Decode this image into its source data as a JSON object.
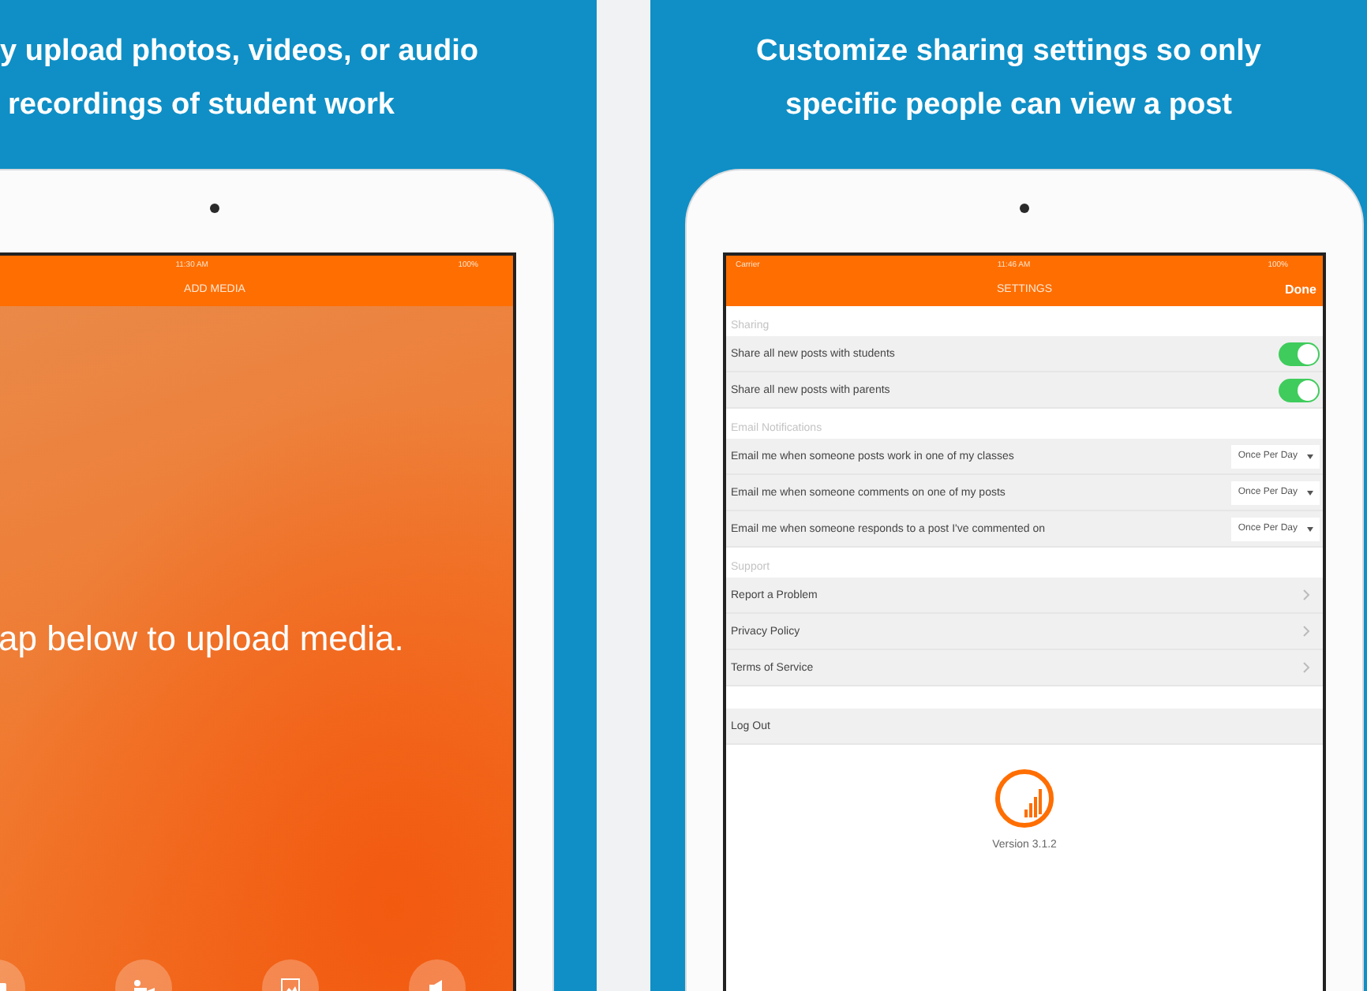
{
  "left_panel": {
    "caption": [
      "y upload photos, videos, or audio",
      "recordings of student work"
    ],
    "screen": {
      "time": "11:30 AM",
      "battery": "100%",
      "title": "ADD MEDIA",
      "prompt": "ap below to upload media."
    }
  },
  "right_panel": {
    "caption": [
      "Customize sharing settings so only",
      "specific people can view a post"
    ],
    "screen": {
      "carrier": "Carrier",
      "time": "11:46 AM",
      "battery": "100%",
      "title": "SETTINGS",
      "done": "Done",
      "sections": [
        {
          "header": "Sharing",
          "rows": [
            {
              "kind": "toggle",
              "label": "Share all new posts with students",
              "on": true
            },
            {
              "kind": "toggle",
              "label": "Share all new posts with parents",
              "on": true
            }
          ]
        },
        {
          "header": "Email Notifications",
          "rows": [
            {
              "kind": "select",
              "label": "Email me when someone posts work in one of my classes",
              "value": "Once Per Day"
            },
            {
              "kind": "select",
              "label": "Email me when someone comments on one of my posts",
              "value": "Once Per Day"
            },
            {
              "kind": "select",
              "label": "Email me when someone responds to a post I've commented on",
              "value": "Once Per Day"
            }
          ]
        },
        {
          "header": "Support",
          "rows": [
            {
              "kind": "link",
              "label": "Report a Problem"
            },
            {
              "kind": "link",
              "label": "Privacy Policy"
            },
            {
              "kind": "link",
              "label": "Terms of Service"
            }
          ]
        },
        {
          "rows": [
            {
              "kind": "plain",
              "label": "Log Out"
            }
          ]
        }
      ],
      "version": "Version 3.1.2"
    }
  }
}
